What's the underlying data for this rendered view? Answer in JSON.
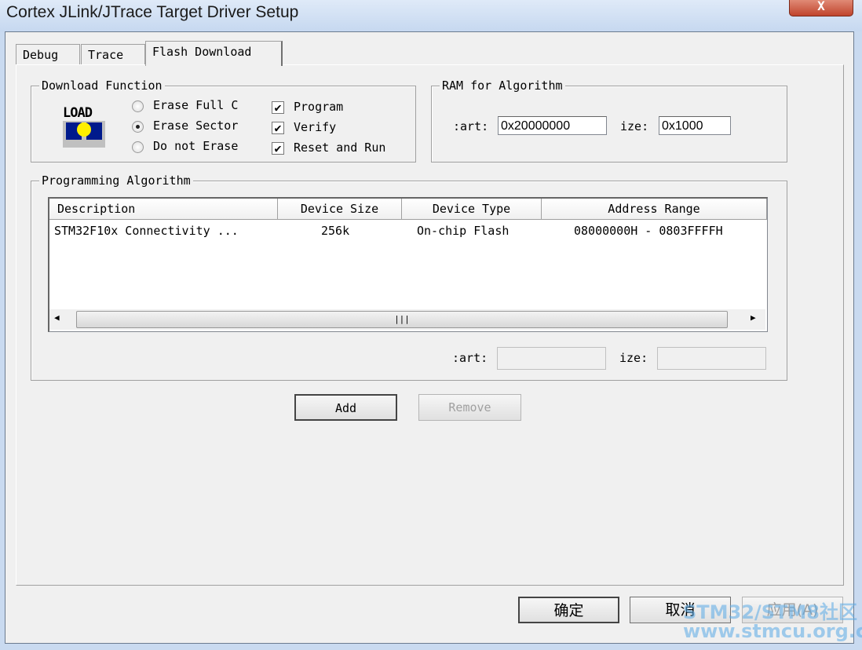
{
  "window": {
    "title": "Cortex JLink/JTrace Target Driver Setup",
    "close_label": "X"
  },
  "tabs": [
    {
      "label": "Debug"
    },
    {
      "label": "Trace"
    },
    {
      "label": "Flash Download",
      "selected": true
    }
  ],
  "download_function": {
    "title": "Download Function",
    "icon_label": "LOAD",
    "erase_options": [
      {
        "label": "Erase Full C",
        "checked": false
      },
      {
        "label": "Erase Sector",
        "checked": true
      },
      {
        "label": "Do not Erase",
        "checked": false
      }
    ],
    "checkboxes": [
      {
        "label": "Program",
        "checked": true
      },
      {
        "label": "Verify",
        "checked": true
      },
      {
        "label": "Reset and Run",
        "checked": true
      }
    ]
  },
  "ram": {
    "title": "RAM for Algorithm",
    "start_label": ":art:",
    "start_value": "0x20000000",
    "size_label": "ize:",
    "size_value": "0x1000"
  },
  "algorithm": {
    "title": "Programming Algorithm",
    "columns": [
      "Description",
      "Device Size",
      "Device Type",
      "Address Range"
    ],
    "rows": [
      [
        "STM32F10x Connectivity ...",
        "256k",
        "On-chip Flash",
        "08000000H - 0803FFFFH"
      ]
    ],
    "start_label": ":art:",
    "start_value": "",
    "size_label": "ize:",
    "size_value": "",
    "add_label": "Add",
    "remove_label": "Remove"
  },
  "footer": {
    "ok": "确定",
    "cancel": "取消",
    "apply": "应用(A)"
  },
  "watermark": {
    "line1": "STM32/STM8社区",
    "line2": "www.stmcu.org.cn"
  }
}
